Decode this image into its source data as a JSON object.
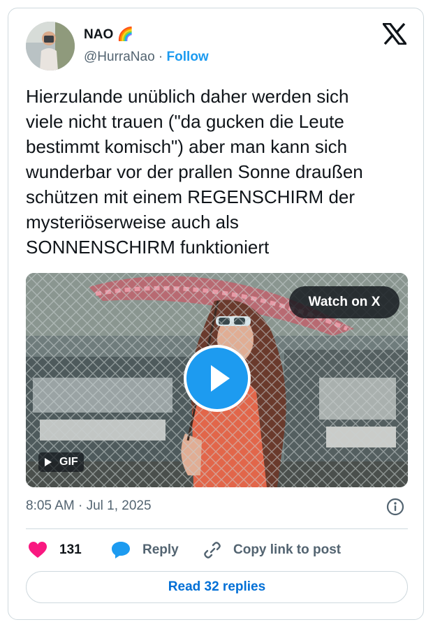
{
  "author": {
    "name": "NAO 🌈",
    "handle": "@HurraNao",
    "separator": " · ",
    "follow_label": "Follow"
  },
  "tweet": {
    "text": "Hierzulande unüblich daher werden sich\nviele nicht trauen (\"da gucken die Leute\nbestimmt komisch\") aber man kann sich\nwunderbar vor der prallen Sonne draußen\nschützen mit einem REGENSCHIRM der\nmysteriöserweise auch als\nSONNENSCHIRM funktioniert",
    "timestamp": "8:05 AM · Jul 1, 2025"
  },
  "media": {
    "watch_label": "Watch on X",
    "badge_label": "GIF"
  },
  "actions": {
    "like_count": "131",
    "reply_label": "Reply",
    "copy_label": "Copy link to post"
  },
  "footer": {
    "read_replies_label": "Read 32 replies"
  },
  "colors": {
    "accent": "#1d9bf0",
    "link": "#006fd6",
    "like": "#f91880",
    "muted": "#536471",
    "text": "#0f1419",
    "border": "#cfd9de"
  }
}
